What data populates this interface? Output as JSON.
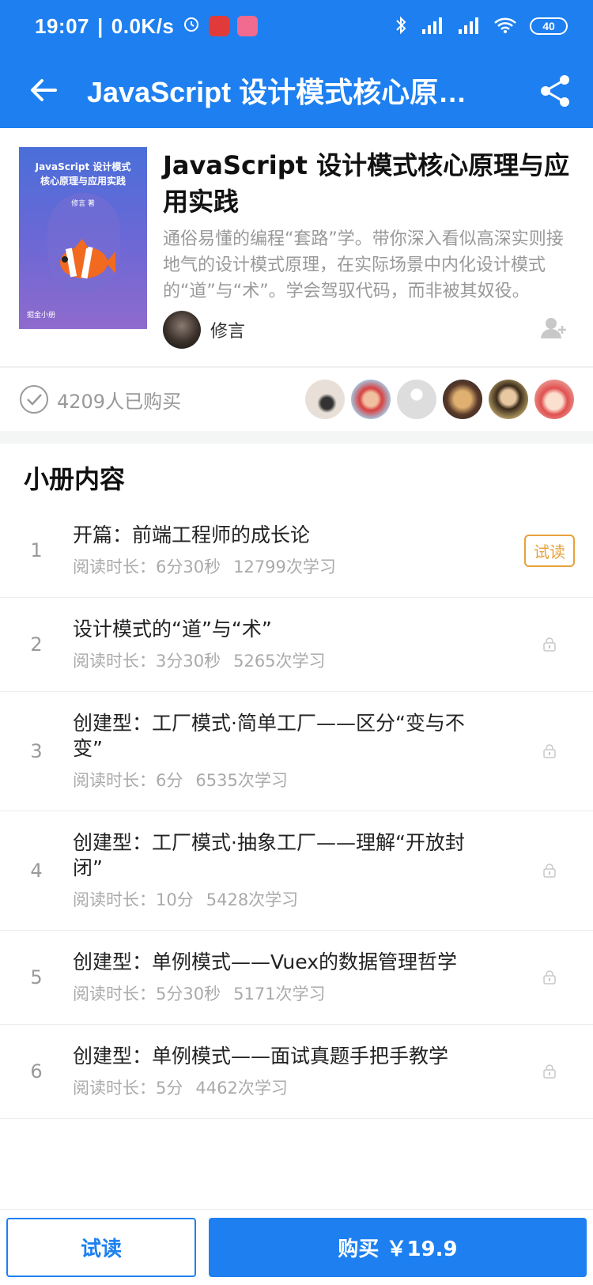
{
  "status_bar": {
    "time": "19:07",
    "speed": "0.0K/s",
    "battery": "40"
  },
  "header": {
    "title": "JavaScript 设计模式核心原…"
  },
  "book": {
    "cover_title": "JavaScript 设计模式\n核心原理与应用实践",
    "cover_author": "修言 著",
    "cover_logo": "掘金小册",
    "title": "JavaScript 设计模式核心原理与应用实践",
    "description": "通俗易懂的编程“套路”学。带你深入看似高深实则接地气的设计模式原理，在实际场景中内化设计模式的“道”与“术”。学会驾驭代码，而非被其奴役。",
    "author": "修言"
  },
  "buyers": {
    "text": "4209人已购买"
  },
  "section": {
    "title": "小册内容"
  },
  "chapters": [
    {
      "num": "1",
      "title": "开篇：前端工程师的成长论",
      "duration": "阅读时长：6分30秒",
      "learners": "12799次学习",
      "badge": "试读"
    },
    {
      "num": "2",
      "title": "设计模式的“道”与“术”",
      "duration": "阅读时长：3分30秒",
      "learners": "5265次学习"
    },
    {
      "num": "3",
      "title": "创建型：工厂模式·简单工厂——区分“变与不变”",
      "duration": "阅读时长：6分",
      "learners": "6535次学习"
    },
    {
      "num": "4",
      "title": "创建型：工厂模式·抽象工厂——理解“开放封闭”",
      "duration": "阅读时长：10分",
      "learners": "5428次学习"
    },
    {
      "num": "5",
      "title": "创建型：单例模式——Vuex的数据管理哲学",
      "duration": "阅读时长：5分30秒",
      "learners": "5171次学习"
    },
    {
      "num": "6",
      "title": "创建型：单例模式——面试真题手把手教学",
      "duration": "阅读时长：5分",
      "learners": "4462次学习"
    }
  ],
  "bottom": {
    "trial_label": "试读",
    "buy_label": "购买 ￥19.9"
  },
  "colors": {
    "primary": "#1e80f0",
    "trial_badge": "#e6a23c"
  }
}
